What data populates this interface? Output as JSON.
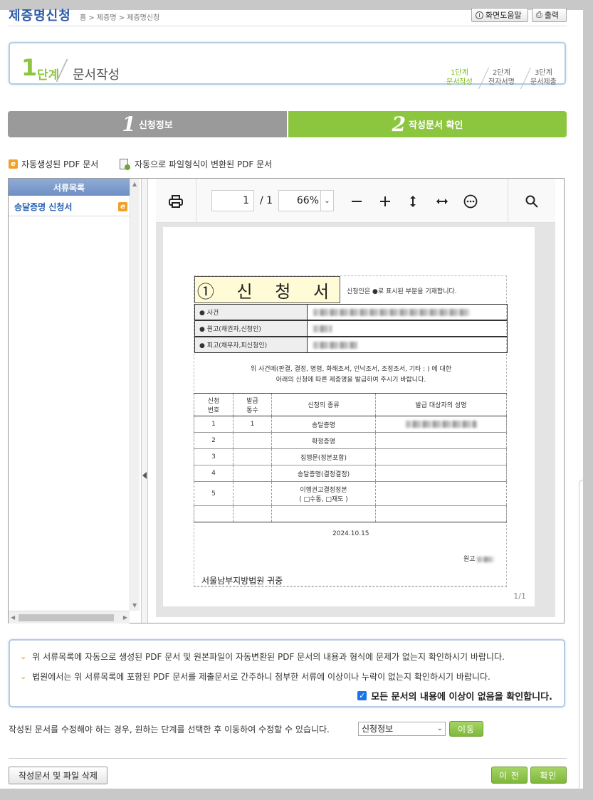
{
  "header": {
    "title": "제증명신청",
    "breadcrumb": "홈 > 제증명 > 제증명신청",
    "help_button": "화면도움말",
    "print_button": "출력"
  },
  "step": {
    "number": "1",
    "unit": "단계",
    "title": "문서작성",
    "steps": [
      {
        "num": "1단계",
        "label": "문서작성"
      },
      {
        "num": "2단계",
        "label": "전자서명"
      },
      {
        "num": "3단계",
        "label": "문서제출"
      }
    ]
  },
  "tabs": [
    {
      "num": "1",
      "label": "신청정보"
    },
    {
      "num": "2",
      "label": "작성문서 확인"
    }
  ],
  "legend": {
    "auto": "자동생성된 PDF 문서",
    "converted": "자동으로 파일형식이 변환된 PDF 문서"
  },
  "doc_list": {
    "header": "서류목록",
    "items": [
      "송달증명 신청서"
    ]
  },
  "viewer": {
    "page": "1",
    "total": "/ 1",
    "zoom": "66%",
    "page_count": "1/1"
  },
  "document": {
    "title": "① 신 청 서",
    "title_note": "신청인은 ●로 표시된 부분을 기재합니다.",
    "rows": [
      "● 사건",
      "● 원고(채권자,신청인)",
      "● 피고(채무자,피신청인)"
    ],
    "text1": "위 사건에(판결, 결정, 명령, 화해조서, 인낙조서, 조정조서, 기타 :                    ) 에 대한",
    "text2": "아래의 신청에 따른 제증명을 발급하여 주시기 바랍니다.",
    "table_header": [
      "신청\n번호",
      "발급\n통수",
      "신청의 종류",
      "발급 대상자의 성명"
    ],
    "table_rows": [
      [
        "1",
        "1",
        "송달증명"
      ],
      [
        "2",
        "",
        "확정증명"
      ],
      [
        "3",
        "",
        "집행문(정본포함)"
      ],
      [
        "4",
        "",
        "송달증명(결정결정)"
      ],
      [
        "5",
        "",
        "이행권고결정정본\n( □수통, □재도 )"
      ],
      [
        "",
        "",
        ""
      ]
    ],
    "date": "2024.10.15",
    "sign": "원고",
    "court": "서울남부지방법원  귀중"
  },
  "notice": {
    "line1": "위 서류목록에 자동으로 생성된 PDF 문서 및 원본파일이 자동변환된 PDF 문서의 내용과 형식에 문제가 없는지 확인하시기 바랍니다.",
    "line2": "법원에서는 위 서류목록에 포함된 PDF 문서를 제출문서로 간주하니 첨부한 서류에 이상이나 누락이 없는지 확인하시기 바랍니다.",
    "confirm": "모든 문서의 내용에 이상이 없음을 확인합니다."
  },
  "modify": {
    "text": "작성된 문서를 수정해야 하는 경우, 원하는 단계를 선택한 후 이동하여 수정할 수 있습니다.",
    "selected": "신청정보",
    "move_button": "이동"
  },
  "footer": {
    "delete_button": "작성문서 및 파일 삭제",
    "prev_button": "이 전",
    "confirm_button": "확인"
  },
  "colors": {
    "accent_green": "#8cc63f",
    "title_blue": "#2b5aa8",
    "checkbox_blue": "#1a73e8"
  }
}
